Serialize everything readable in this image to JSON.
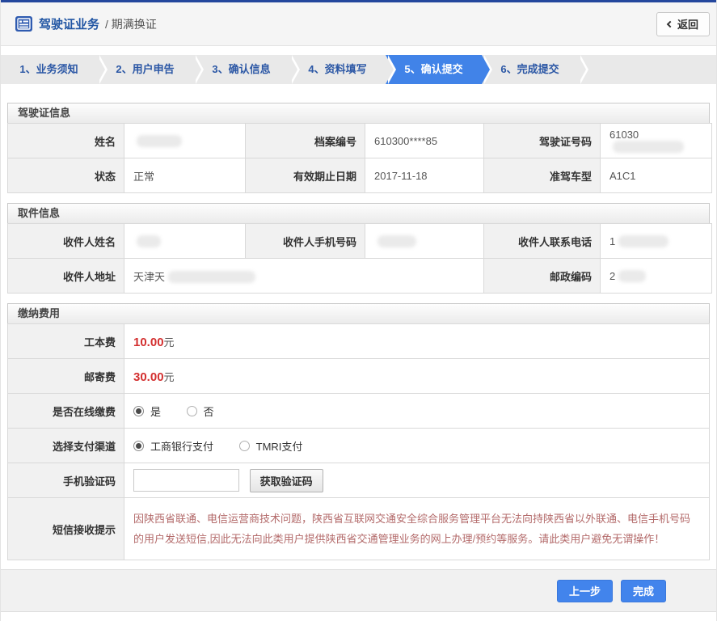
{
  "header": {
    "title": "驾驶证业务",
    "subtitle": "/ 期满换证",
    "back_label": "返回"
  },
  "steps": {
    "active_index": 4,
    "items": [
      {
        "label": "1、业务须知"
      },
      {
        "label": "2、用户申告"
      },
      {
        "label": "3、确认信息"
      },
      {
        "label": "4、资料填写"
      },
      {
        "label": "5、确认提交"
      },
      {
        "label": "6、完成提交"
      }
    ]
  },
  "license_info": {
    "title": "驾驶证信息",
    "name_label": "姓名",
    "file_number_label": "档案编号",
    "file_number": "610300****85",
    "license_number_label": "驾驶证号码",
    "license_number_prefix": "61030",
    "status_label": "状态",
    "status": "正常",
    "expiry_label": "有效期止日期",
    "expiry_date": "2017-11-18",
    "vehicle_class_label": "准驾车型",
    "vehicle_class": "A1C1"
  },
  "pickup_info": {
    "title": "取件信息",
    "recipient_name_label": "收件人姓名",
    "recipient_mobile_label": "收件人手机号码",
    "recipient_phone_label": "收件人联系电话",
    "recipient_phone_prefix": "1",
    "address_label": "收件人地址",
    "address_prefix": "天津天",
    "postal_label": "邮政编码",
    "postal_prefix": "2"
  },
  "payment": {
    "title": "缴纳费用",
    "card_fee_label": "工本费",
    "card_fee": "10.00",
    "postage_fee_label": "邮寄费",
    "postage_fee": "30.00",
    "unit": "元",
    "online_pay_label": "是否在线缴费",
    "online_yes": "是",
    "online_no": "否",
    "online_selected": "是",
    "channel_label": "选择支付渠道",
    "channel_icbc": "工商银行支付",
    "channel_tmri": "TMRI支付",
    "channel_selected": "工商银行支付",
    "sms_code_label": "手机验证码",
    "sms_code_value": "",
    "get_code_button": "获取验证码",
    "sms_tip_label": "短信接收提示",
    "sms_tip": "因陕西省联通、电信运营商技术问题，陕西省互联网交通安全综合服务管理平台无法向持陕西省以外联通、电信手机号码的用户发送短信,因此无法向此类用户提供陕西省交通管理业务的网上办理/预约等服务。请此类用户避免无谓操作！"
  },
  "footer": {
    "prev_button": "上一步",
    "finish_button": "完成"
  },
  "colors": {
    "top_bar_navy": "#24479d",
    "step_active_blue": "#4183e8",
    "step_text_blue": "#2b57a5",
    "button_blue": "#4284ec",
    "fee_red": "#d32f2f",
    "notice_red": "#b36a6a"
  }
}
